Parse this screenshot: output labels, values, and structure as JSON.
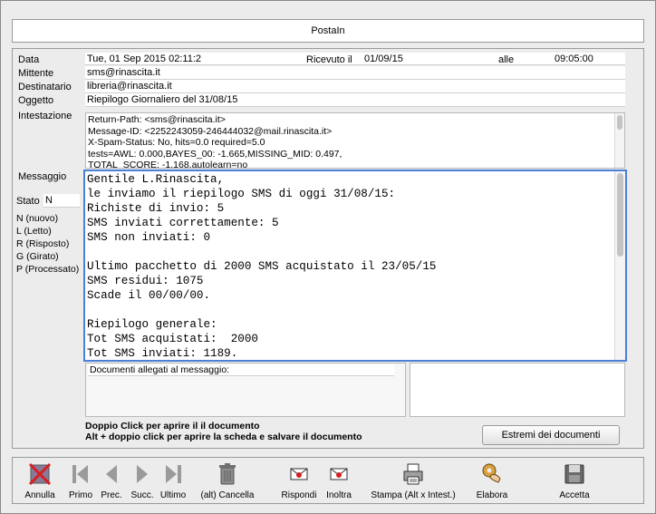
{
  "window": {
    "title": "PostaIn"
  },
  "fields": {
    "data_label": "Data",
    "data_value": "Tue, 01 Sep 2015 02:11:2",
    "ricevuto_label": "Ricevuto il",
    "ricevuto_value": "01/09/15",
    "alle_label": "alle",
    "alle_value": "09:05:00",
    "mittente_label": "Mittente",
    "mittente_value": "sms@rinascita.it",
    "destinatario_label": "Destinatario",
    "destinatario_value": "libreria@rinascita.it",
    "oggetto_label": "Oggetto",
    "oggetto_value": "Riepilogo Giornaliero del 31/08/15",
    "intestazione_label": "Intestazione",
    "messaggio_label": "Messaggio",
    "stato_label": "Stato",
    "stato_value": "N"
  },
  "header_lines": [
    "Return-Path: <sms@rinascita.it>",
    "Message-ID: <2252243059-246444032@mail.rinascita.it>",
    "X-Spam-Status: No, hits=0.0 required=5.0",
    "        tests=AWL: 0.000,BAYES_00: -1.665,MISSING_MID: 0.497,",
    "        TOTAL_SCORE: -1.168,autolearn=no"
  ],
  "message_lines": [
    "Gentile L.Rinascita,",
    "le inviamo il riepilogo SMS di oggi 31/08/15:",
    "Richiste di invio: 5",
    "SMS inviati correttamente: 5",
    "SMS non inviati: 0",
    "",
    "Ultimo pacchetto di 2000 SMS acquistato il 23/05/15",
    "SMS residui: 1075",
    "Scade il 00/00/00.",
    "",
    "Riepilogo generale:",
    "Tot SMS acquistati:  2000",
    "Tot SMS inviati: 1189."
  ],
  "status_legend": [
    "N (nuovo)",
    "L (Letto)",
    "R (Risposto)",
    "G (Girato)",
    "P (Processato)"
  ],
  "attachments": {
    "header": "Documenti allegati al messaggio:"
  },
  "hints": {
    "line1": "Doppio Click per aprire il il documento",
    "line2": "Alt + doppio click per aprire la scheda e salvare il documento"
  },
  "estremi_button": "Estremi dei documenti",
  "toolbar": [
    {
      "label": "Annulla",
      "icon": "cancel-icon"
    },
    {
      "label": "Primo",
      "icon": "first-icon"
    },
    {
      "label": "Prec.",
      "icon": "previous-icon"
    },
    {
      "label": "Succ.",
      "icon": "next-icon"
    },
    {
      "label": "Ultimo",
      "icon": "last-icon"
    },
    {
      "label": "(alt) Cancella",
      "icon": "trash-icon"
    },
    {
      "label": "Rispondi",
      "icon": "reply-icon"
    },
    {
      "label": "Inoltra",
      "icon": "forward-icon"
    },
    {
      "label": "Stampa (Alt x Intest.)",
      "icon": "print-icon"
    },
    {
      "label": "Elabora",
      "icon": "process-icon"
    },
    {
      "label": "Accetta",
      "icon": "accept-icon"
    }
  ]
}
